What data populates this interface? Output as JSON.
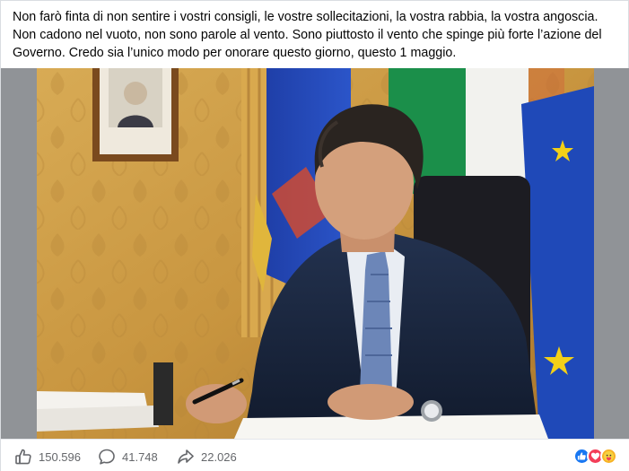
{
  "post": {
    "text": "Non farò finta di non sentire i vostri consigli, le vostre sollecitazioni, la vostra rabbia, la vostra angoscia. Non cadono nel vuoto, non sono parole al vento. Sono piuttosto il vento che spinge più forte l’azione del Governo. Credo sia l’unico modo per onorare questo giorno, questo 1 maggio."
  },
  "stats": {
    "likes": "150.596",
    "comments": "41.748",
    "shares": "22.026"
  },
  "icons": {
    "like": "thumbs-up-icon",
    "comment": "speech-bubble-icon",
    "share": "share-arrow-icon",
    "reactions": [
      "like-reaction-icon",
      "love-reaction-icon",
      "care-reaction-icon"
    ]
  },
  "colors": {
    "like_blue": "#1877f2",
    "love_red": "#f33e58",
    "care_yellow": "#f7b125",
    "muted_text": "#65676b"
  }
}
